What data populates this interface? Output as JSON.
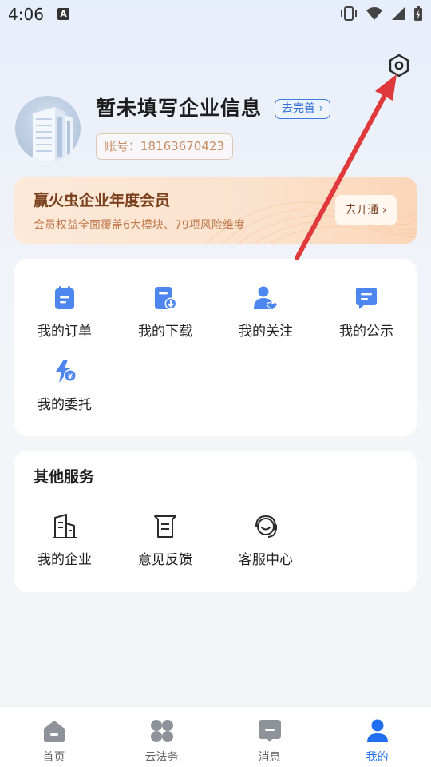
{
  "status_bar": {
    "time": "4:06",
    "notification_icon": "A"
  },
  "header": {
    "company_name": "暂未填写企业信息",
    "complete_label": "去完善 ›",
    "account_label": "账号：18163670423",
    "settings_icon": "gear-icon"
  },
  "vip": {
    "title": "赢火虫企业年度会员",
    "subtitle": "会员权益全面覆盖6大模块、79项风险维度",
    "button": "去开通 ›"
  },
  "my_services": [
    {
      "label": "我的订单",
      "icon": "order-icon"
    },
    {
      "label": "我的下载",
      "icon": "download-icon"
    },
    {
      "label": "我的关注",
      "icon": "follow-icon"
    },
    {
      "label": "我的公示",
      "icon": "notice-icon"
    },
    {
      "label": "我的委托",
      "icon": "entrust-icon"
    }
  ],
  "other_services": {
    "title": "其他服务",
    "items": [
      {
        "label": "我的企业",
        "icon": "building-icon"
      },
      {
        "label": "意见反馈",
        "icon": "feedback-icon"
      },
      {
        "label": "客服中心",
        "icon": "headset-icon"
      }
    ]
  },
  "tabbar": [
    {
      "label": "首页",
      "icon": "home-icon",
      "active": false
    },
    {
      "label": "云法务",
      "icon": "grid-icon",
      "active": false
    },
    {
      "label": "消息",
      "icon": "message-icon",
      "active": false
    },
    {
      "label": "我的",
      "icon": "profile-icon",
      "active": true
    }
  ],
  "colors": {
    "accent": "#1f6ff0",
    "icon_blue": "#4d86ee",
    "vip_brown": "#7a3f1b",
    "annotation_arrow": "#e0393b"
  }
}
